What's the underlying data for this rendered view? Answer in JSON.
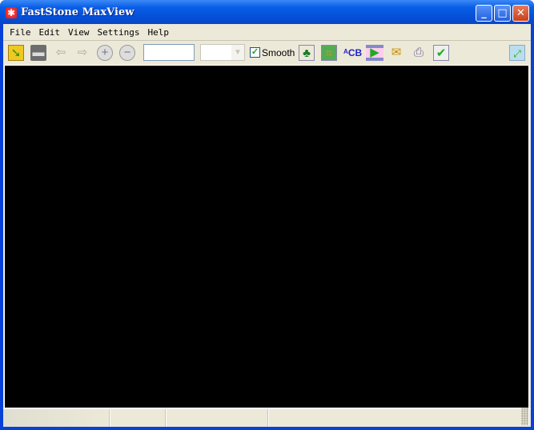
{
  "window": {
    "title": "FastStone MaxView"
  },
  "menu": [
    "File",
    "Edit",
    "View",
    "Settings",
    "Help"
  ],
  "toolbar": {
    "zoom_value": "",
    "smooth_label": "Smooth",
    "smooth_checked": true
  },
  "status": [
    "",
    "",
    "",
    ""
  ]
}
